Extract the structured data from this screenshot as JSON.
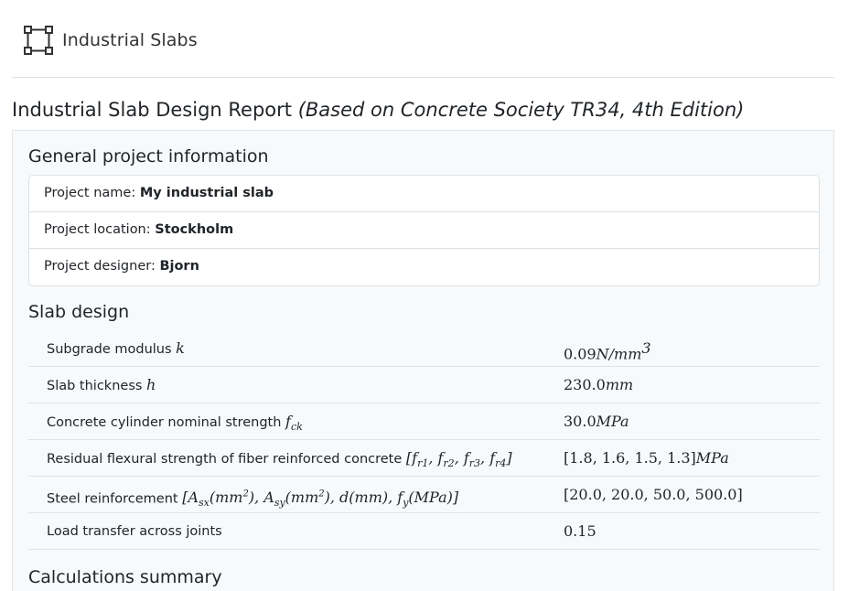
{
  "navbar": {
    "brand_icon": "vector-square-icon",
    "brand_text": "Industrial Slabs"
  },
  "report": {
    "title": "Industrial Slab Design Report",
    "subtitle": "(Based on Concrete Society TR34, 4th Edition)"
  },
  "general": {
    "title": "General project information",
    "items": [
      {
        "label": "Project name:",
        "value": "My industrial slab"
      },
      {
        "label": "Project location:",
        "value": "Stockholm"
      },
      {
        "label": "Project designer:",
        "value": "Bjorn"
      }
    ]
  },
  "slab_design": {
    "title": "Slab design",
    "rows": [
      {
        "label": "Subgrade modulus",
        "symbol": "k",
        "value": "0.09",
        "unit": "N/mm",
        "unit_exp": "3"
      },
      {
        "label": "Slab thickness",
        "symbol": "h",
        "value": "230.0",
        "unit": "mm"
      },
      {
        "label": "Concrete cylinder nominal strength",
        "symbol": "f",
        "symbol_sub": "ck",
        "value": "30.0",
        "unit": "MPa"
      },
      {
        "label": "Residual flexural strength of fiber reinforced concrete",
        "symbol": "[f_r1, f_r2, f_r3, f_r4]",
        "value": "[1.8, 1.6, 1.5, 1.3]",
        "unit": "MPa"
      },
      {
        "label": "Steel reinforcement",
        "symbol": "[A_sx(mm^2), A_sy(mm^2), d(mm), f_y(MPa)]",
        "value": "[20.0, 20.0, 50.0, 500.0]"
      },
      {
        "label": "Load transfer across joints",
        "value": "0.15"
      }
    ]
  },
  "calculations": {
    "title": "Calculations summary"
  }
}
